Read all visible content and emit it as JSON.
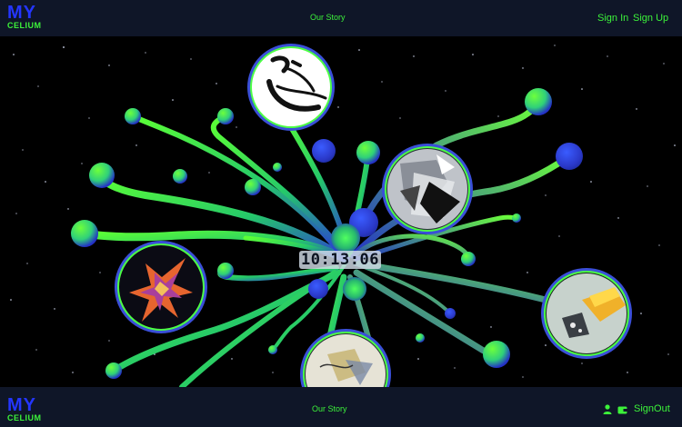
{
  "header": {
    "logo_top": "MY",
    "logo_bottom": "CELIUM",
    "our_story": "Our Story",
    "sign_in": "Sign In",
    "sign_up": "Sign Up"
  },
  "clock": {
    "time": "10:13:06"
  },
  "footer": {
    "logo_top": "MY",
    "logo_bottom": "CELIUM",
    "our_story": "Our Story",
    "sign_out": "SignOut",
    "icons": [
      "user-icon",
      "wallet-icon"
    ]
  },
  "colors": {
    "brand_blue": "#2436ff",
    "brand_green": "#3cf23a",
    "bar_bg": "#0f1628"
  },
  "nodes": [
    {
      "name": "node-ink-sketch",
      "icon": "ink-stroke-artwork"
    },
    {
      "name": "node-gray-collage",
      "icon": "monochrome-collage-artwork"
    },
    {
      "name": "node-crystal-shard",
      "icon": "crystal-shard-artwork"
    },
    {
      "name": "node-yellow-block",
      "icon": "yellow-block-artwork"
    },
    {
      "name": "node-sketch-bottom",
      "icon": "pale-sketch-artwork"
    }
  ]
}
